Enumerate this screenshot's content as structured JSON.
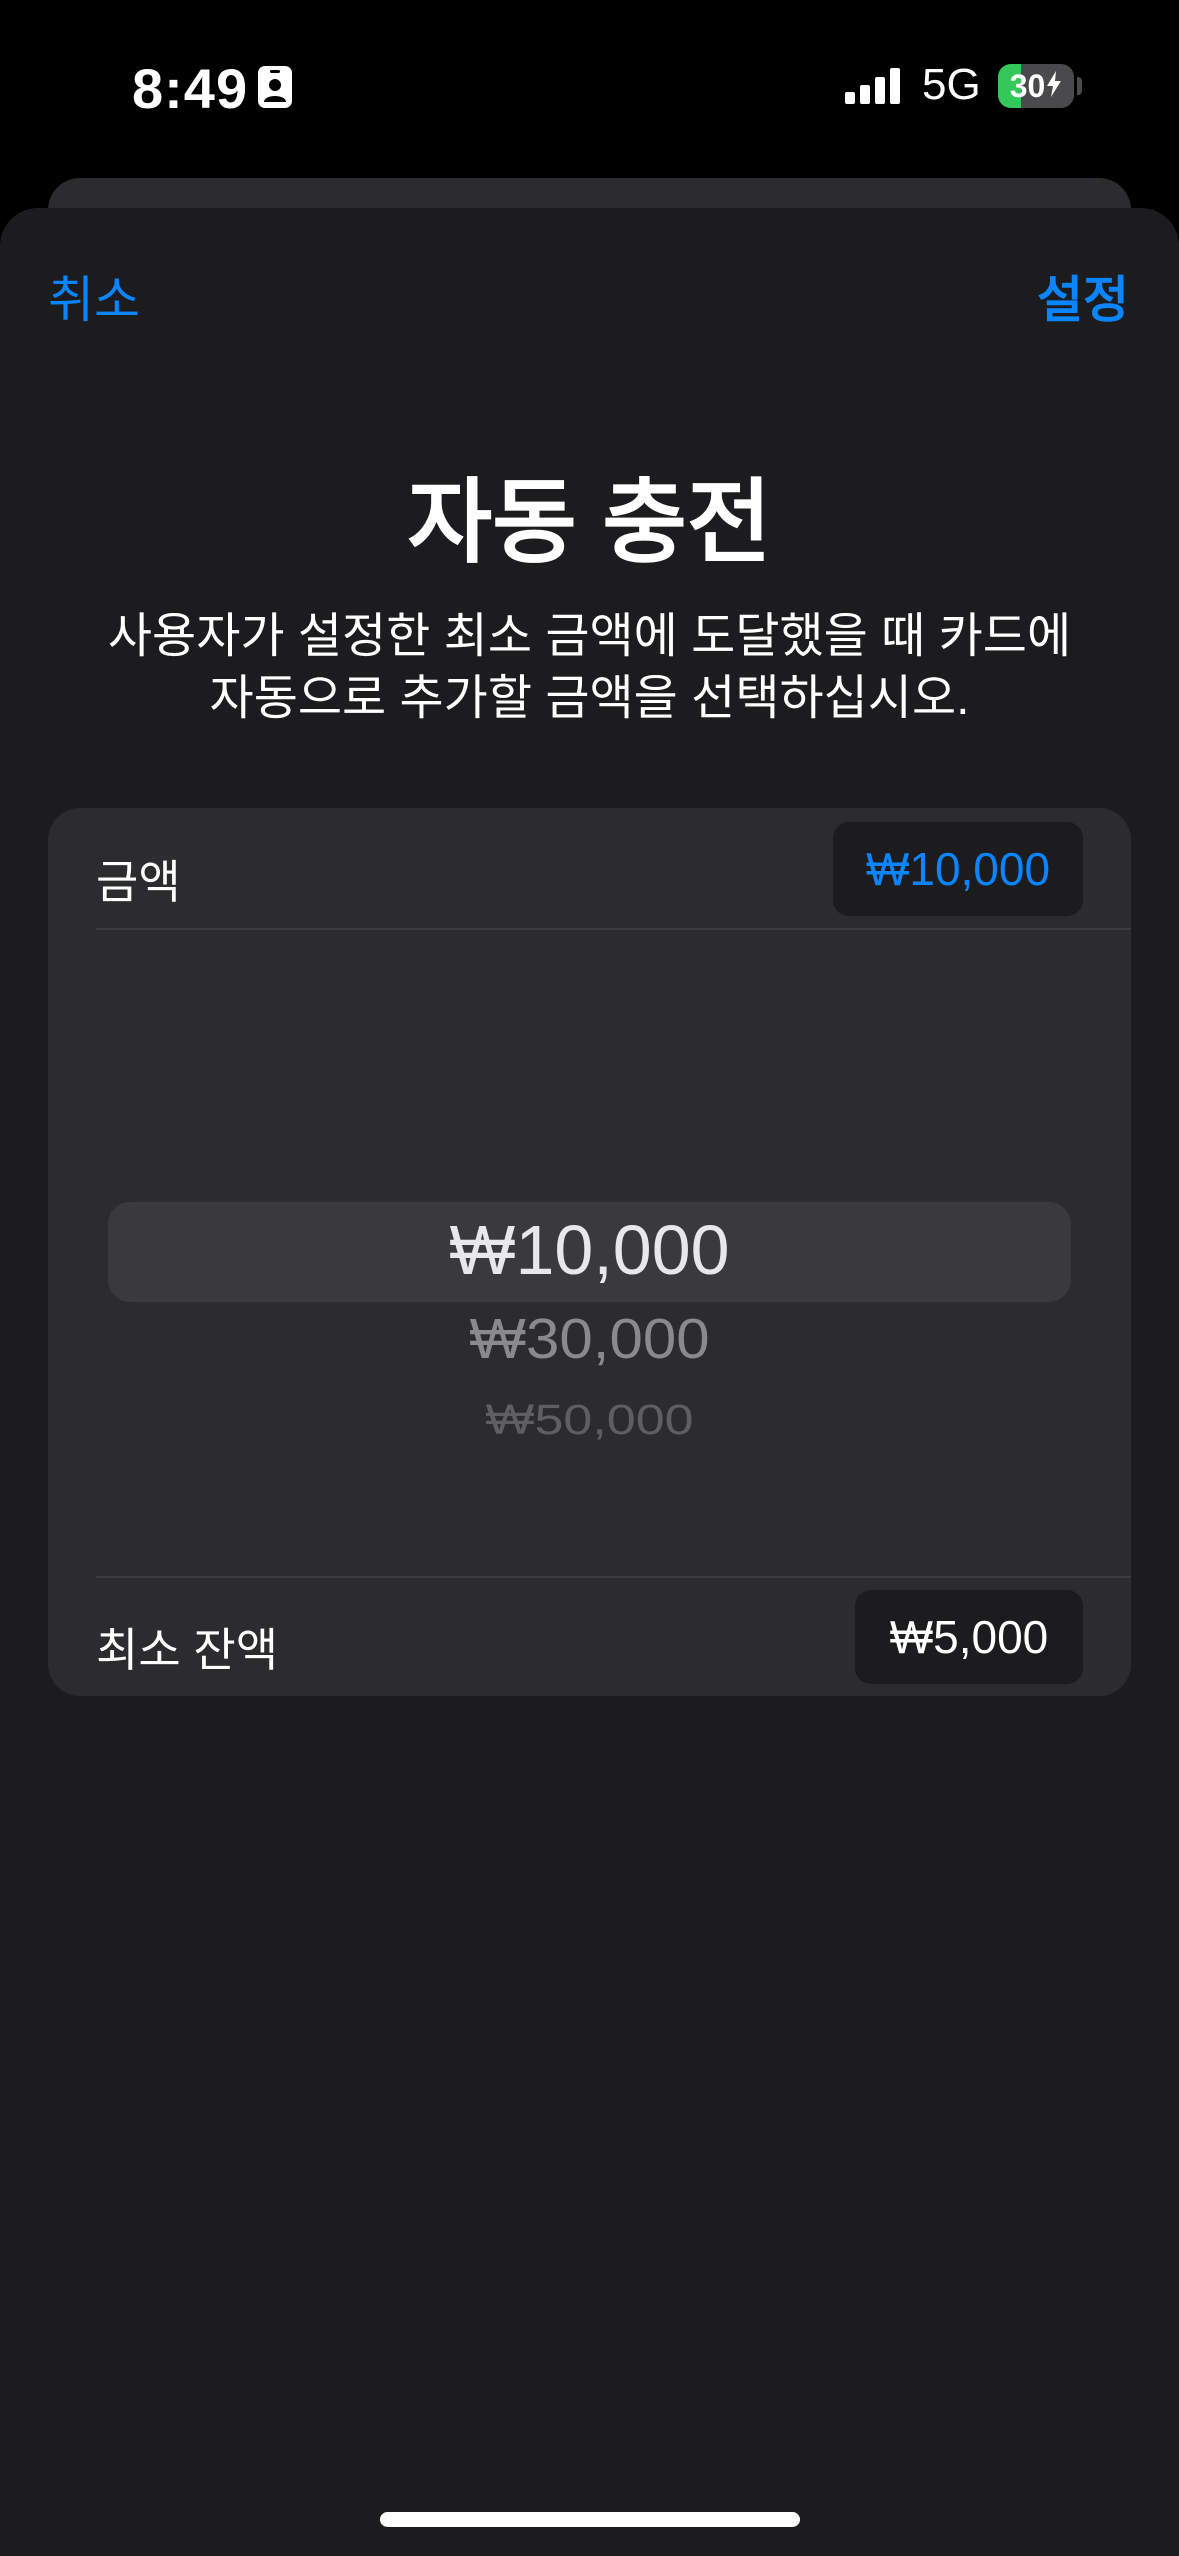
{
  "status_bar": {
    "time": "8:49",
    "network": "5G",
    "battery": "30",
    "battery_level": 0.3,
    "icons": [
      "contact-card-icon",
      "signal-bars-icon",
      "charging-bolt-icon"
    ]
  },
  "nav": {
    "cancel_label": "취소",
    "set_label": "설정"
  },
  "header": {
    "title": "자동 충전",
    "subtitle": "사용자가 설정한 최소 금액에 도달했을 때 카드에 자동으로 추가할 금액을 선택하십시오."
  },
  "settings": {
    "amount_label": "금액",
    "amount_value": "₩10,000",
    "picker_options": [
      "₩10,000",
      "₩30,000",
      "₩50,000"
    ],
    "picker_selected": "₩10,000",
    "min_balance_label": "최소 잔액",
    "min_balance_value": "₩5,000"
  },
  "colors": {
    "accent": "#0a84ff",
    "background": "#1c1c1e",
    "card": "#2c2c2e",
    "battery_fill": "#34c759"
  }
}
